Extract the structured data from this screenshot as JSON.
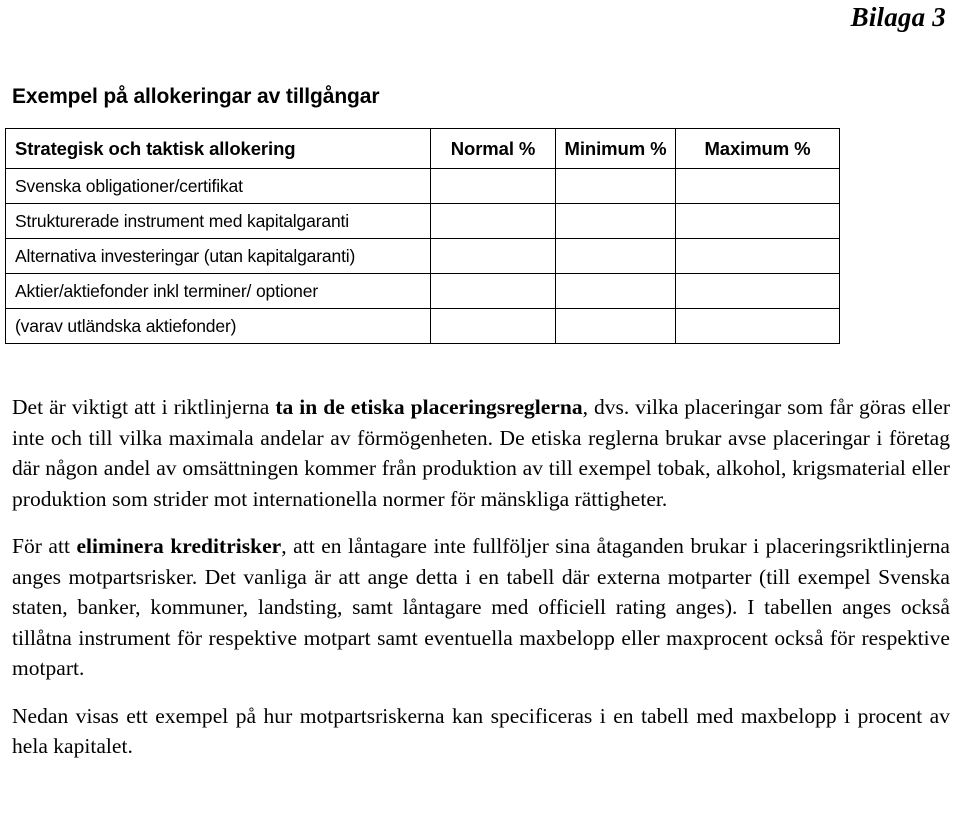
{
  "running_head": "Bilaga 3",
  "section": {
    "title": "Exempel på allokeringar av tillgångar"
  },
  "alloc_table": {
    "headers": [
      "Strategisk och taktisk allokering",
      "Normal %",
      "Minimum %",
      "Maximum %"
    ],
    "rows": [
      {
        "label": "Svenska obligationer/certifikat",
        "normal": "",
        "minimum": "",
        "maximum": ""
      },
      {
        "label": "Strukturerade instrument med kapitalgaranti",
        "normal": "",
        "minimum": "",
        "maximum": ""
      },
      {
        "label": "Alternativa investeringar (utan kapitalgaranti)",
        "normal": "",
        "minimum": "",
        "maximum": ""
      },
      {
        "label": "Aktier/aktiefonder inkl terminer/ optioner",
        "normal": "",
        "minimum": "",
        "maximum": ""
      },
      {
        "label": "(varav utländska aktiefonder)",
        "normal": "",
        "minimum": "",
        "maximum": ""
      }
    ]
  },
  "paragraphs": {
    "p1": {
      "before_bold": "Det är viktigt att i riktlinjerna ",
      "bold": "ta in de etiska placeringsreglerna",
      "after_bold": ", dvs. vilka placeringar som får göras eller inte och till vilka maximala andelar av förmögenheten. De etiska reglerna brukar avse placeringar i företag där någon andel av omsättningen kommer från produktion av till exempel tobak, alkohol, krigsmaterial eller produktion som strider mot internationella normer för mänskliga rättigheter."
    },
    "p2": {
      "before_bold": "För att ",
      "bold": "eliminera kreditrisker",
      "after_bold": ", att en låntagare inte fullföljer sina åtaganden brukar i placeringsriktlinjerna anges motpartsrisker. Det vanliga är att ange detta i en tabell där externa motparter (till exempel Svenska staten, banker, kommuner, landsting, samt låntagare med officiell rating anges). I tabellen anges också tillåtna instrument för respektive motpart samt eventuella maxbelopp eller maxprocent också för respektive motpart."
    },
    "p3": {
      "text": "Nedan visas ett exempel på hur motpartsriskerna kan specificeras i en tabell med maxbelopp i procent av hela kapitalet."
    }
  }
}
